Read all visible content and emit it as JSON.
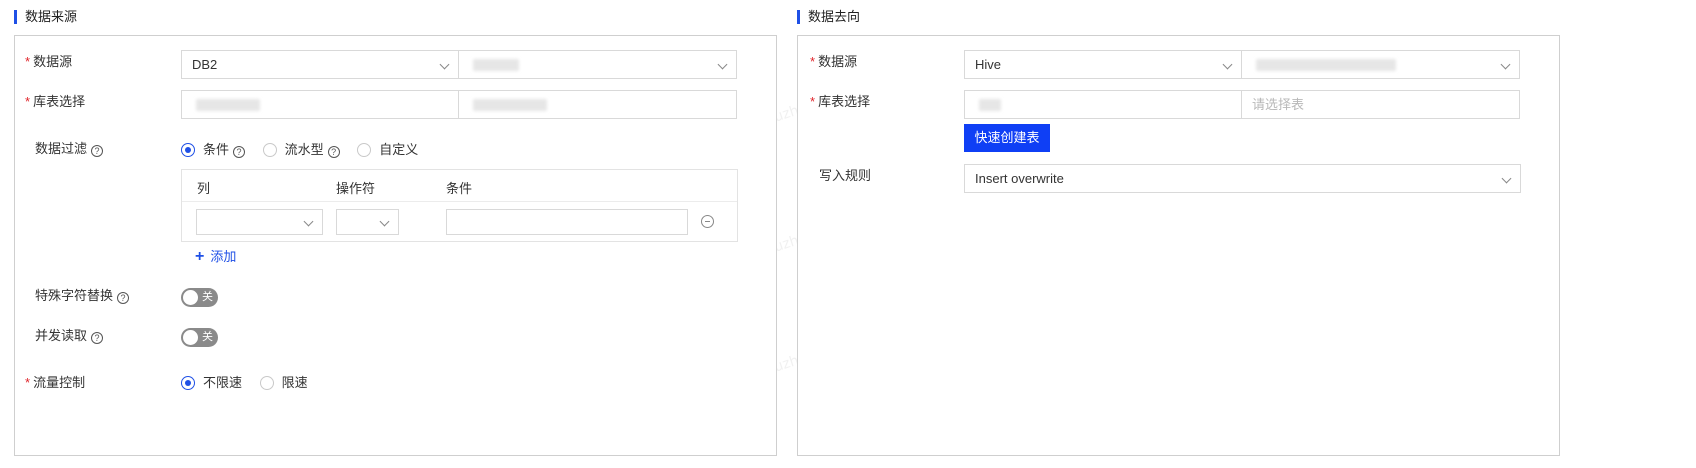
{
  "source": {
    "section_title": "数据来源",
    "datasource": {
      "label": "数据源",
      "type_value": "DB2",
      "instance_value": ""
    },
    "table_select": {
      "label": "库表选择",
      "db_value": "",
      "table_value": ""
    },
    "data_filter": {
      "label": "数据过滤",
      "options": [
        "条件",
        "流水型",
        "自定义"
      ],
      "selected": "条件",
      "columns": [
        "列",
        "操作符",
        "条件"
      ],
      "row": {
        "column": "",
        "operator": "",
        "condition": ""
      },
      "add_label": "添加"
    },
    "special_char": {
      "label": "特殊字符替换",
      "toggle_label": "关",
      "enabled": false
    },
    "concurrent_read": {
      "label": "并发读取",
      "toggle_label": "关",
      "enabled": false
    },
    "flow_control": {
      "label": "流量控制",
      "options": [
        "不限速",
        "限速"
      ],
      "selected": "不限速"
    }
  },
  "target": {
    "section_title": "数据去向",
    "datasource": {
      "label": "数据源",
      "type_value": "Hive",
      "instance_value": ""
    },
    "table_select": {
      "label": "库表选择",
      "db_value": "",
      "table_placeholder": "请选择表"
    },
    "quick_create_label": "快速创建表",
    "write_rule": {
      "label": "写入规则",
      "value": "Insert overwrite"
    }
  },
  "watermark_text": "fuzheng03",
  "colors": {
    "accent": "#1f50e6",
    "primary_button": "#0f3ff5",
    "required": "#e0242a",
    "toggle_off": "#8a8a8a",
    "border": "#cfcfcf"
  },
  "icons": {
    "help": "question-circle-icon",
    "dropdown": "chevron-down-icon",
    "remove": "minus-circle-icon",
    "add": "plus-icon"
  }
}
